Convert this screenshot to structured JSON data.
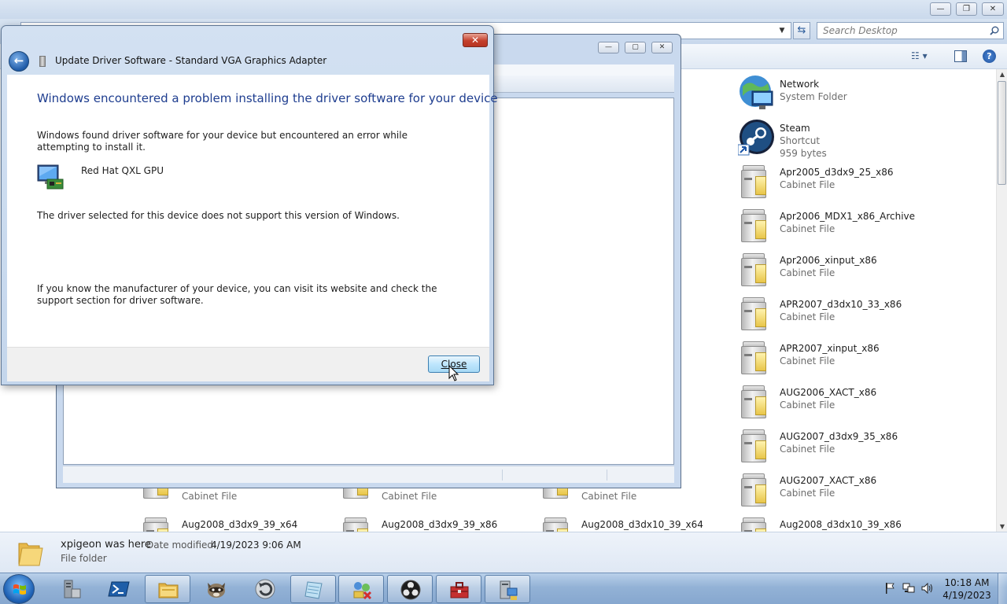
{
  "explorer": {
    "search_placeholder": "Search Desktop",
    "items_right": [
      {
        "name": "Network",
        "type": "System Folder",
        "size": "",
        "icon": "network-icon"
      },
      {
        "name": "Steam",
        "type": "Shortcut",
        "size": "959 bytes",
        "icon": "steam-icon"
      },
      {
        "name": "Apr2005_d3dx9_25_x86",
        "type": "Cabinet File",
        "size": "",
        "icon": "cabinet-icon"
      },
      {
        "name": "Apr2006_MDX1_x86_Archive",
        "type": "Cabinet File",
        "size": "",
        "icon": "cabinet-icon"
      },
      {
        "name": "Apr2006_xinput_x86",
        "type": "Cabinet File",
        "size": "",
        "icon": "cabinet-icon"
      },
      {
        "name": "APR2007_d3dx10_33_x86",
        "type": "Cabinet File",
        "size": "",
        "icon": "cabinet-icon"
      },
      {
        "name": "APR2007_xinput_x86",
        "type": "Cabinet File",
        "size": "",
        "icon": "cabinet-icon"
      },
      {
        "name": "AUG2006_XACT_x86",
        "type": "Cabinet File",
        "size": "",
        "icon": "cabinet-icon"
      },
      {
        "name": "AUG2007_d3dx9_35_x86",
        "type": "Cabinet File",
        "size": "",
        "icon": "cabinet-icon"
      },
      {
        "name": "AUG2007_XACT_x86",
        "type": "Cabinet File",
        "size": "",
        "icon": "cabinet-icon"
      },
      {
        "name": "Aug2008_d3dx10_39_x86",
        "type": "",
        "size": "",
        "icon": "cabinet-icon"
      }
    ],
    "items_bottom": [
      {
        "name": "",
        "type": "Cabinet File"
      },
      {
        "name": "",
        "type": "Cabinet File"
      },
      {
        "name": "",
        "type": "Cabinet File"
      },
      {
        "name": "Aug2008_d3dx9_39_x64",
        "type": ""
      },
      {
        "name": "Aug2008_d3dx9_39_x86",
        "type": ""
      },
      {
        "name": "Aug2008_d3dx10_39_x64",
        "type": ""
      }
    ],
    "status": {
      "name": "xpigeon was here",
      "date_label": "Date modified:",
      "date_value": "4/19/2023 9:06 AM",
      "type": "File folder"
    }
  },
  "dialog": {
    "title": "Update Driver Software - Standard VGA Graphics Adapter",
    "heading": "Windows encountered a problem installing the driver software for your device",
    "message1": "Windows found driver software for your device but encountered an error while attempting to install it.",
    "device_name": "Red Hat QXL GPU",
    "message2": "The driver selected for this device does not support this version of Windows.",
    "message3": "If you know the manufacturer of your device, you can visit its website and check the support section for driver software.",
    "close_label": "Close",
    "close_x": "✕",
    "back_glyph": "←"
  },
  "taskbar": {
    "buttons": [
      {
        "icon": "server-manager-icon",
        "active": false
      },
      {
        "icon": "powershell-icon",
        "active": false
      },
      {
        "icon": "file-explorer-icon",
        "active": true
      },
      {
        "icon": "raccoon-app-icon",
        "active": false
      },
      {
        "icon": "refresh-app-icon",
        "active": false
      },
      {
        "icon": "notepad-icon",
        "active": true
      },
      {
        "icon": "network-tools-icon",
        "active": true
      },
      {
        "icon": "obs-icon",
        "active": true
      },
      {
        "icon": "toolbox-icon",
        "active": true
      },
      {
        "icon": "device-manager-icon",
        "active": true
      }
    ],
    "clock_time": "10:18 AM",
    "clock_date": "4/19/2023"
  },
  "colors": {
    "dialog_heading": "#1e3d8f",
    "taskbar": "#93b2d6",
    "close_x_button": "#c4402d"
  }
}
